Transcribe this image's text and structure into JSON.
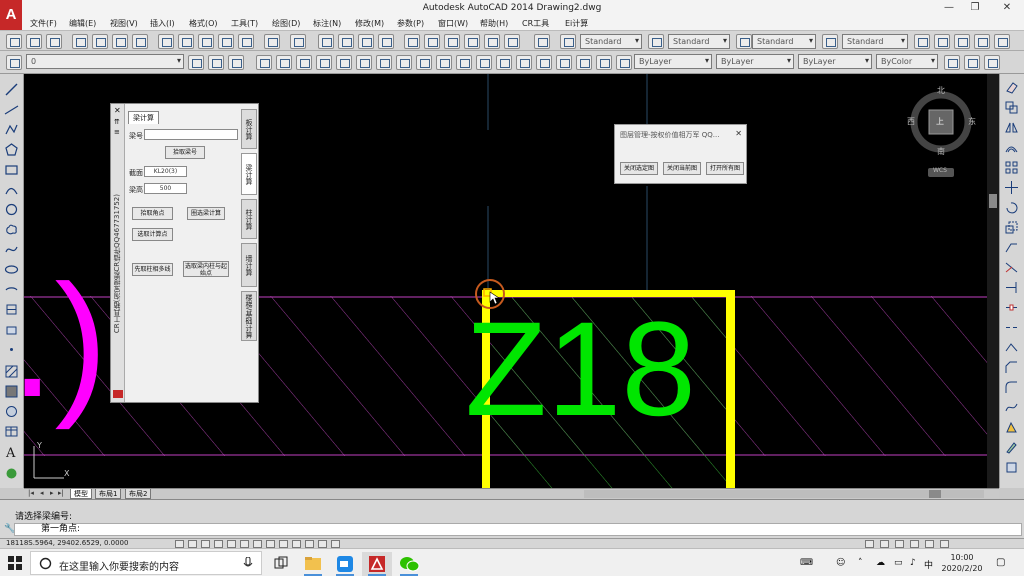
{
  "window": {
    "title": "Autodesk AutoCAD 2014   Drawing2.dwg",
    "logo": "A",
    "minimize": "—",
    "restore": "❐",
    "close": "✕"
  },
  "menu": [
    "文件(F)",
    "编辑(E)",
    "视图(V)",
    "插入(I)",
    "格式(O)",
    "工具(T)",
    "绘图(D)",
    "标注(N)",
    "修改(M)",
    "参数(P)",
    "窗口(W)",
    "帮助(H)",
    "CR工具",
    "Ei计算"
  ],
  "toolbar": {
    "styles": [
      "Standard",
      "Standard",
      "Standard",
      "Standard"
    ],
    "layer": "0",
    "color": "ByLayer",
    "linetype": "ByLayer",
    "lineweight": "ByLayer",
    "plotstyle": "ByColor"
  },
  "canvas": {
    "drawing_text": "Z18",
    "left_fragment": ".)",
    "ucs_x": "X",
    "ucs_y": "Y",
    "accent_colors": {
      "yellow": "#ffff00",
      "green": "#00e600",
      "magenta": "#ff00ff",
      "hatch": "#b040b0"
    }
  },
  "viewcube": {
    "north": "北",
    "south": "南",
    "east": "东",
    "west": "西",
    "top": "上",
    "wcs": "WCS"
  },
  "palette": {
    "vertical_title": "CR工具箱(淘宝搜索CR插件QQ467731752)",
    "tab": "梁计算",
    "label_name": "梁号",
    "name_value": "",
    "pick_button": "拾取梁号",
    "label_size": "截面",
    "size_value": "KL20(3)",
    "label_height": "梁高",
    "height_value": "500",
    "btn_pick_point": "拾取角点",
    "btn_calc": "圈选梁计算",
    "btn_select_point": "选取计算点",
    "btn_multi": "先取柱相多线",
    "btn_other": "选取梁内柱与起始点",
    "right_tabs": [
      "板计算",
      "梁计算",
      "柱计算",
      "墙计算",
      "楼梯/基础计算"
    ]
  },
  "layer_dialog": {
    "title": "图层管理-按权价值相万军 QQ...",
    "close": "✕",
    "buttons": [
      "关闭选定图",
      "关闭当前图",
      "打开所有图"
    ]
  },
  "layout_tabs": [
    "模型",
    "布局1",
    "布局2"
  ],
  "command": {
    "history": "请选择梁编号:",
    "prompt": "第一角点:"
  },
  "status": {
    "coords": "18118S.5964, 29402.6529, 0.0000"
  },
  "taskbar": {
    "search_placeholder": "在这里输入你要搜索的内容",
    "time": "10:00",
    "date": "2020/2/20"
  }
}
